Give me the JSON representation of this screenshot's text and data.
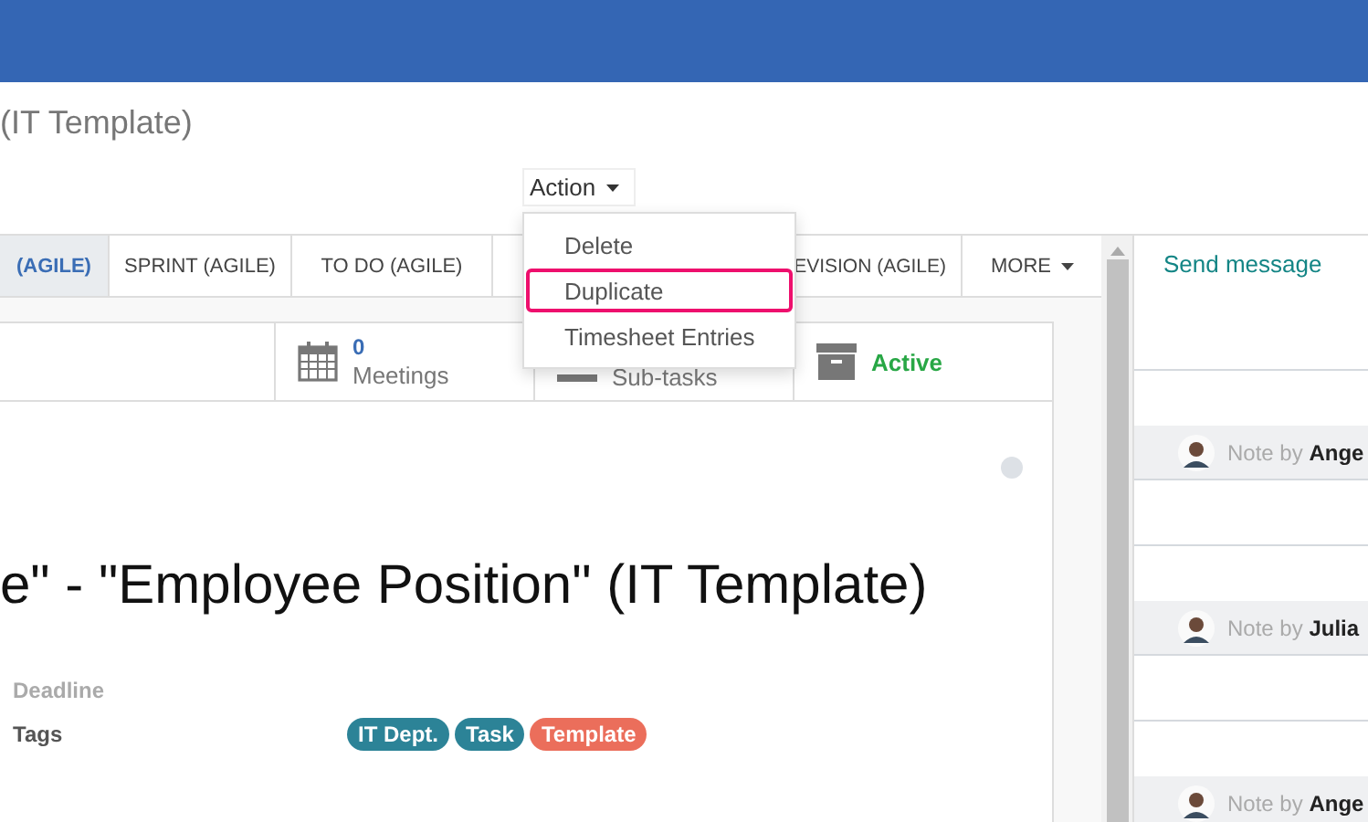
{
  "breadcrumb": "(IT Template)",
  "action_menu": {
    "label": "Action",
    "items": [
      {
        "label": "Delete",
        "highlighted": false
      },
      {
        "label": "Duplicate",
        "highlighted": true
      },
      {
        "label": "Timesheet Entries",
        "highlighted": false
      }
    ]
  },
  "stages": [
    {
      "label": "(AGILE)",
      "selected": true
    },
    {
      "label": "SPRINT (AGILE)",
      "selected": false
    },
    {
      "label": "TO DO (AGILE)",
      "selected": false
    },
    {
      "label": "EVISION (AGILE)",
      "selected": false
    }
  ],
  "stages_more": "MORE",
  "smart_buttons": [
    {
      "kind": "meetings",
      "count": "0",
      "label": "Meetings"
    },
    {
      "kind": "subtasks",
      "label": "Sub-tasks"
    },
    {
      "kind": "active",
      "label": "Active"
    }
  ],
  "title": "e\" - \"Employee Position\" (IT Template)",
  "fields": [
    {
      "label": "Deadline",
      "muted": true
    },
    {
      "label": "Tags",
      "muted": false
    }
  ],
  "tags": [
    {
      "label": "IT Dept.",
      "color": "#2c8397"
    },
    {
      "label": "Task",
      "color": "#2c8397"
    },
    {
      "label": "Template",
      "color": "#eb6e5b"
    }
  ],
  "chatter": {
    "send_message": "Send message",
    "notes": [
      {
        "prefix": "Note by",
        "author": "Ange"
      },
      {
        "prefix": "Note by",
        "author": "Julia"
      },
      {
        "prefix": "Note by",
        "author": "Ange"
      }
    ]
  }
}
